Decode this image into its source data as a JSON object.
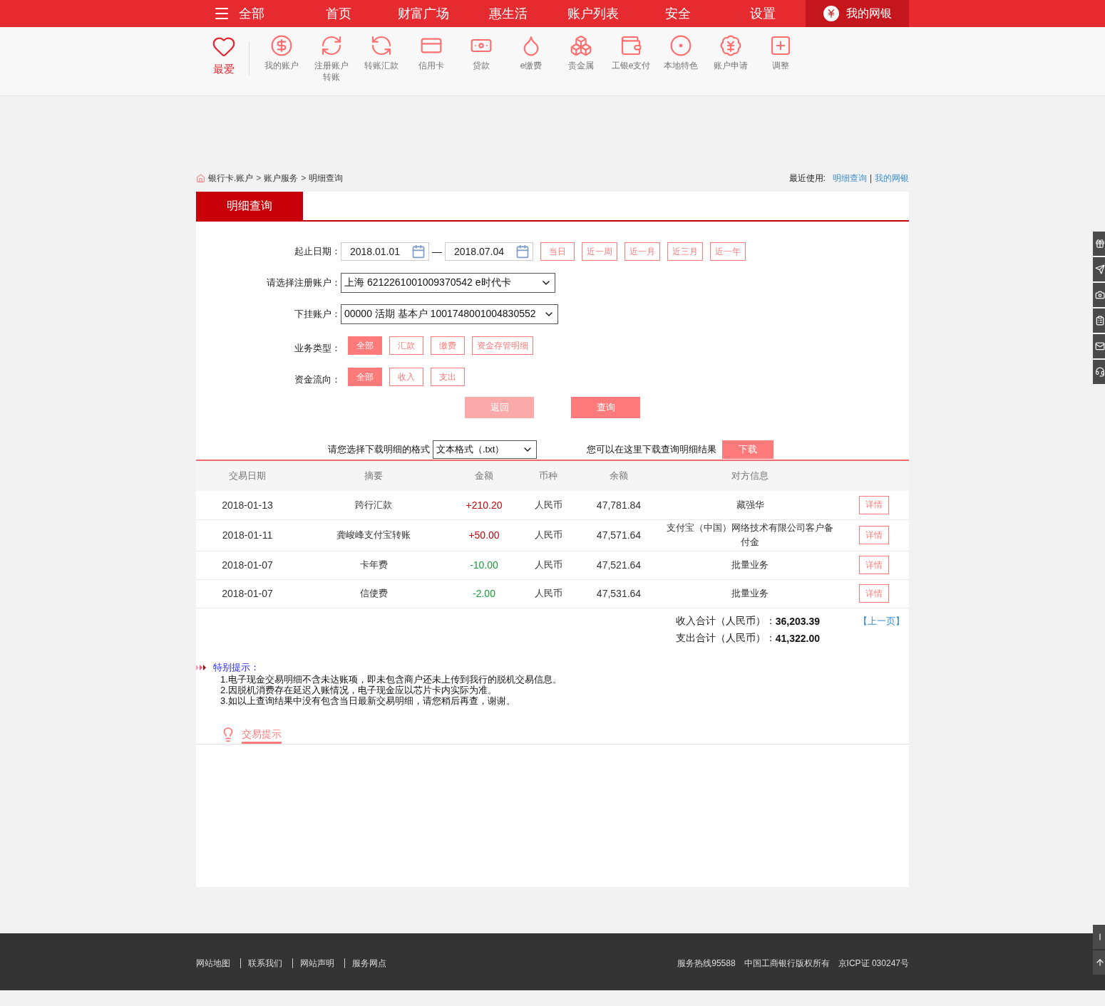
{
  "nav": {
    "menu_label": "全部",
    "items": [
      {
        "label": "首页"
      },
      {
        "label": "财富广场"
      },
      {
        "label": "惠生活"
      },
      {
        "label": "账户列表"
      },
      {
        "label": "安全"
      },
      {
        "label": "设置"
      }
    ],
    "my_bank": "我的网银"
  },
  "shortcuts": {
    "favorite": "最爱",
    "items": [
      {
        "label": "我的账户"
      },
      {
        "label": "注册账户转账"
      },
      {
        "label": "转账汇款"
      },
      {
        "label": "信用卡"
      },
      {
        "label": "贷款"
      },
      {
        "label": "e缴费"
      },
      {
        "label": "贵金属"
      },
      {
        "label": "工银e支付"
      },
      {
        "label": "本地特色"
      },
      {
        "label": "账户申请"
      },
      {
        "label": "调整"
      }
    ]
  },
  "breadcrumb": {
    "items": [
      "银行卡.账户",
      "账户服务",
      "明细查询"
    ],
    "separator": ">"
  },
  "recent": {
    "label": "最近使用:",
    "links": [
      "明细查询",
      "我的网银"
    ],
    "separator": "|"
  },
  "panel_title": "明细查询",
  "form": {
    "date_label": "起止日期：",
    "start_date": "2018.01.01",
    "date_separator": "—",
    "end_date": "2018.07.04",
    "quick_ranges": [
      "当日",
      "近一周",
      "近一月",
      "近三月",
      "近一年"
    ],
    "account_label": "请选择注册账户：",
    "account": "上海 6212261001009370542 e时代卡",
    "sub_account_label": "下挂账户：",
    "sub_account": "00000 活期 基本户 1001748001004830552",
    "type_label": "业务类型：",
    "types": [
      {
        "label": "全部",
        "selected": true
      },
      {
        "label": "汇款",
        "selected": false
      },
      {
        "label": "缴费",
        "selected": false
      },
      {
        "label": "资金存管明细",
        "selected": false
      }
    ],
    "flow_label": "资金流向：",
    "flows": [
      {
        "label": "全部",
        "selected": true
      },
      {
        "label": "收入",
        "selected": false
      },
      {
        "label": "支出",
        "selected": false
      }
    ],
    "back_button": {
      "label": "返回",
      "disabled": true
    },
    "query_button": {
      "label": "查询",
      "disabled": false
    }
  },
  "download": {
    "format_label": "请您选择下载明细的格式",
    "format": "文本格式（.txt）",
    "hint": "您可以在这里下载查询明细结果",
    "button": "下载"
  },
  "table": {
    "columns": [
      "交易日期",
      "摘要",
      "金额",
      "币种",
      "余额",
      "对方信息"
    ],
    "rows": [
      {
        "date": "2018-01-13",
        "summary": "跨行汇款",
        "amount": "+210.20",
        "kind": "income",
        "currency": "人民币",
        "balance": "47,781.84",
        "counterparty": "藏强华",
        "action": "详情"
      },
      {
        "date": "2018-01-11",
        "summary": "龚峻峰支付宝转账",
        "amount": "+50.00",
        "kind": "income",
        "currency": "人民币",
        "balance": "47,571.64",
        "counterparty": "支付宝（中国）网络技术有限公司客户备付金",
        "action": "详情"
      },
      {
        "date": "2018-01-07",
        "summary": "卡年费",
        "amount": "-10.00",
        "kind": "expense",
        "currency": "人民币",
        "balance": "47,521.64",
        "counterparty": "批量业务",
        "action": "详情"
      },
      {
        "date": "2018-01-07",
        "summary": "信使费",
        "amount": "-2.00",
        "kind": "expense",
        "currency": "人民币",
        "balance": "47,531.64",
        "counterparty": "批量业务",
        "action": "详情"
      }
    ]
  },
  "totals": [
    {
      "label": "收入合计（人民币）：",
      "value": "36,203.39"
    },
    {
      "label": "支出合计（人民币）：",
      "value": "41,322.00"
    }
  ],
  "prev_page": "【上一页】",
  "notes": {
    "title": "特别提示：",
    "lines": [
      "1.电子现金交易明细不含未达账项，即未包含商户还未上传到我行的脱机交易信息。",
      "2.因脱机消费存在延迟入账情况，电子现金应以芯片卡内实际为准。",
      "3.如以上查询结果中没有包含当日最新交易明细，请您稍后再查，谢谢。"
    ]
  },
  "tip_tab": "交易提示",
  "footer": {
    "links": [
      "网站地图",
      "联系我们",
      "网站声明",
      "服务网点"
    ],
    "info": [
      "服务热线95588",
      "中国工商银行版权所有",
      "京ICP证 030247号"
    ]
  }
}
